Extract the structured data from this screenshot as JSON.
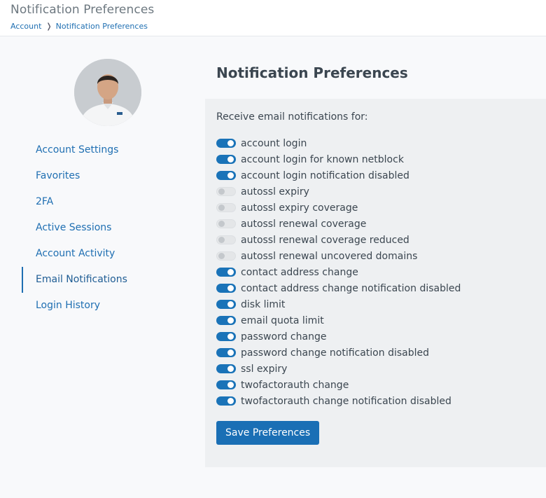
{
  "header": {
    "title": "Notification Preferences",
    "breadcrumb": [
      {
        "label": "Account"
      },
      {
        "label": "Notification Preferences"
      }
    ]
  },
  "sidebar": {
    "items": [
      {
        "label": "Account Settings",
        "active": false
      },
      {
        "label": "Favorites",
        "active": false
      },
      {
        "label": "2FA",
        "active": false
      },
      {
        "label": "Active Sessions",
        "active": false
      },
      {
        "label": "Account Activity",
        "active": false
      },
      {
        "label": "Email Notifications",
        "active": true
      },
      {
        "label": "Login History",
        "active": false
      }
    ]
  },
  "main": {
    "title": "Notification Preferences",
    "panel_heading": "Receive email notifications for:",
    "preferences": [
      {
        "label": "account login",
        "enabled": true
      },
      {
        "label": "account login for known netblock",
        "enabled": true
      },
      {
        "label": "account login notification disabled",
        "enabled": true
      },
      {
        "label": "autossl expiry",
        "enabled": false
      },
      {
        "label": "autossl expiry coverage",
        "enabled": false
      },
      {
        "label": "autossl renewal coverage",
        "enabled": false
      },
      {
        "label": "autossl renewal coverage reduced",
        "enabled": false
      },
      {
        "label": "autossl renewal uncovered domains",
        "enabled": false
      },
      {
        "label": "contact address change",
        "enabled": true
      },
      {
        "label": "contact address change notification disabled",
        "enabled": true
      },
      {
        "label": "disk limit",
        "enabled": true
      },
      {
        "label": "email quota limit",
        "enabled": true
      },
      {
        "label": "password change",
        "enabled": true
      },
      {
        "label": "password change notification disabled",
        "enabled": true
      },
      {
        "label": "ssl expiry",
        "enabled": true
      },
      {
        "label": "twofactorauth change",
        "enabled": true
      },
      {
        "label": "twofactorauth change notification disabled",
        "enabled": true
      }
    ],
    "save_label": "Save Preferences"
  },
  "colors": {
    "accent": "#1a73b8",
    "link": "#1f6fb2",
    "toggle_off": "#e4e6e8",
    "panel_bg": "#eef0f2",
    "page_bg": "#f8f9fb"
  }
}
